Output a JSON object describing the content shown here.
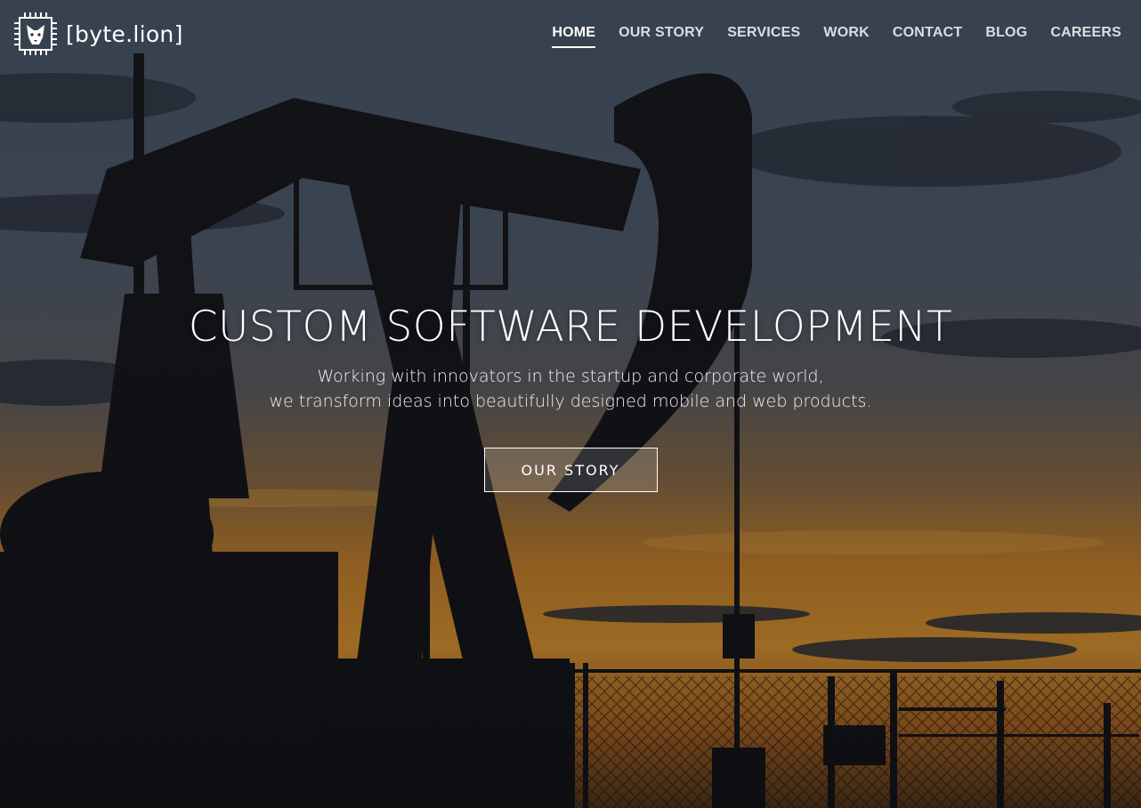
{
  "brand": {
    "name": "[byte.lion]",
    "logo_icon": "lion-chip-icon"
  },
  "nav": {
    "items": [
      {
        "label": "HOME",
        "active": true
      },
      {
        "label": "OUR STORY",
        "active": false
      },
      {
        "label": "SERVICES",
        "active": false
      },
      {
        "label": "WORK",
        "active": false
      },
      {
        "label": "CONTACT",
        "active": false
      },
      {
        "label": "BLOG",
        "active": false
      },
      {
        "label": "CAREERS",
        "active": false
      }
    ]
  },
  "hero": {
    "title": "CUSTOM SOFTWARE DEVELOPMENT",
    "subtitle_line1": "Working with innovators in the startup and corporate world,",
    "subtitle_line2": "we transform ideas into beautifully designed mobile and web products.",
    "cta_label": "OUR STORY",
    "background": "oil-pump-jack-sunset-image"
  },
  "colors": {
    "sky_top": "#3d4a5a",
    "sky_horizon": "#d88a2a",
    "silhouette": "#14151a",
    "text": "#ffffff"
  }
}
